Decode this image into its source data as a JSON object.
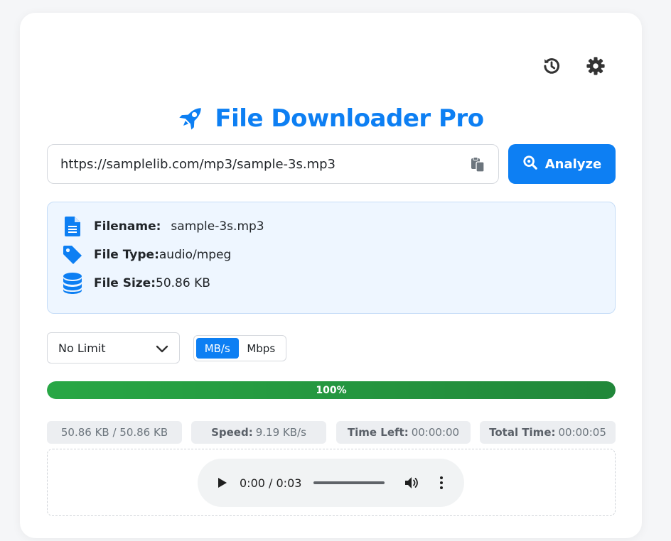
{
  "app": {
    "title": "File Downloader Pro",
    "accent_color": "#0d7ff3",
    "header_icons": [
      "history-icon",
      "gear-icon"
    ]
  },
  "url_bar": {
    "value": "https://samplelib.com/mp3/sample-3s.mp3",
    "paste_icon": "clipboard-paste-icon",
    "analyze_label": "Analyze"
  },
  "file_info": {
    "filename_label": "Filename:",
    "filename_value": "sample-3s.mp3",
    "type_label": "File Type:",
    "type_value": "audio/mpeg",
    "size_label": "File Size:",
    "size_value": "50.86 KB"
  },
  "controls": {
    "speed_limit": "No Limit",
    "units": [
      "MB/s",
      "Mbps"
    ],
    "active_unit": "MB/s"
  },
  "progress": {
    "percent": 100,
    "label": "100%",
    "color": "#28a745"
  },
  "stats": {
    "downloaded": "50.86 KB / 50.86 KB",
    "speed_label": "Speed:",
    "speed_value": "9.19 KB/s",
    "time_left_label": "Time Left:",
    "time_left_value": "00:00:00",
    "total_time_label": "Total Time:",
    "total_time_value": "00:00:05"
  },
  "player": {
    "time": "0:00 / 0:03"
  }
}
